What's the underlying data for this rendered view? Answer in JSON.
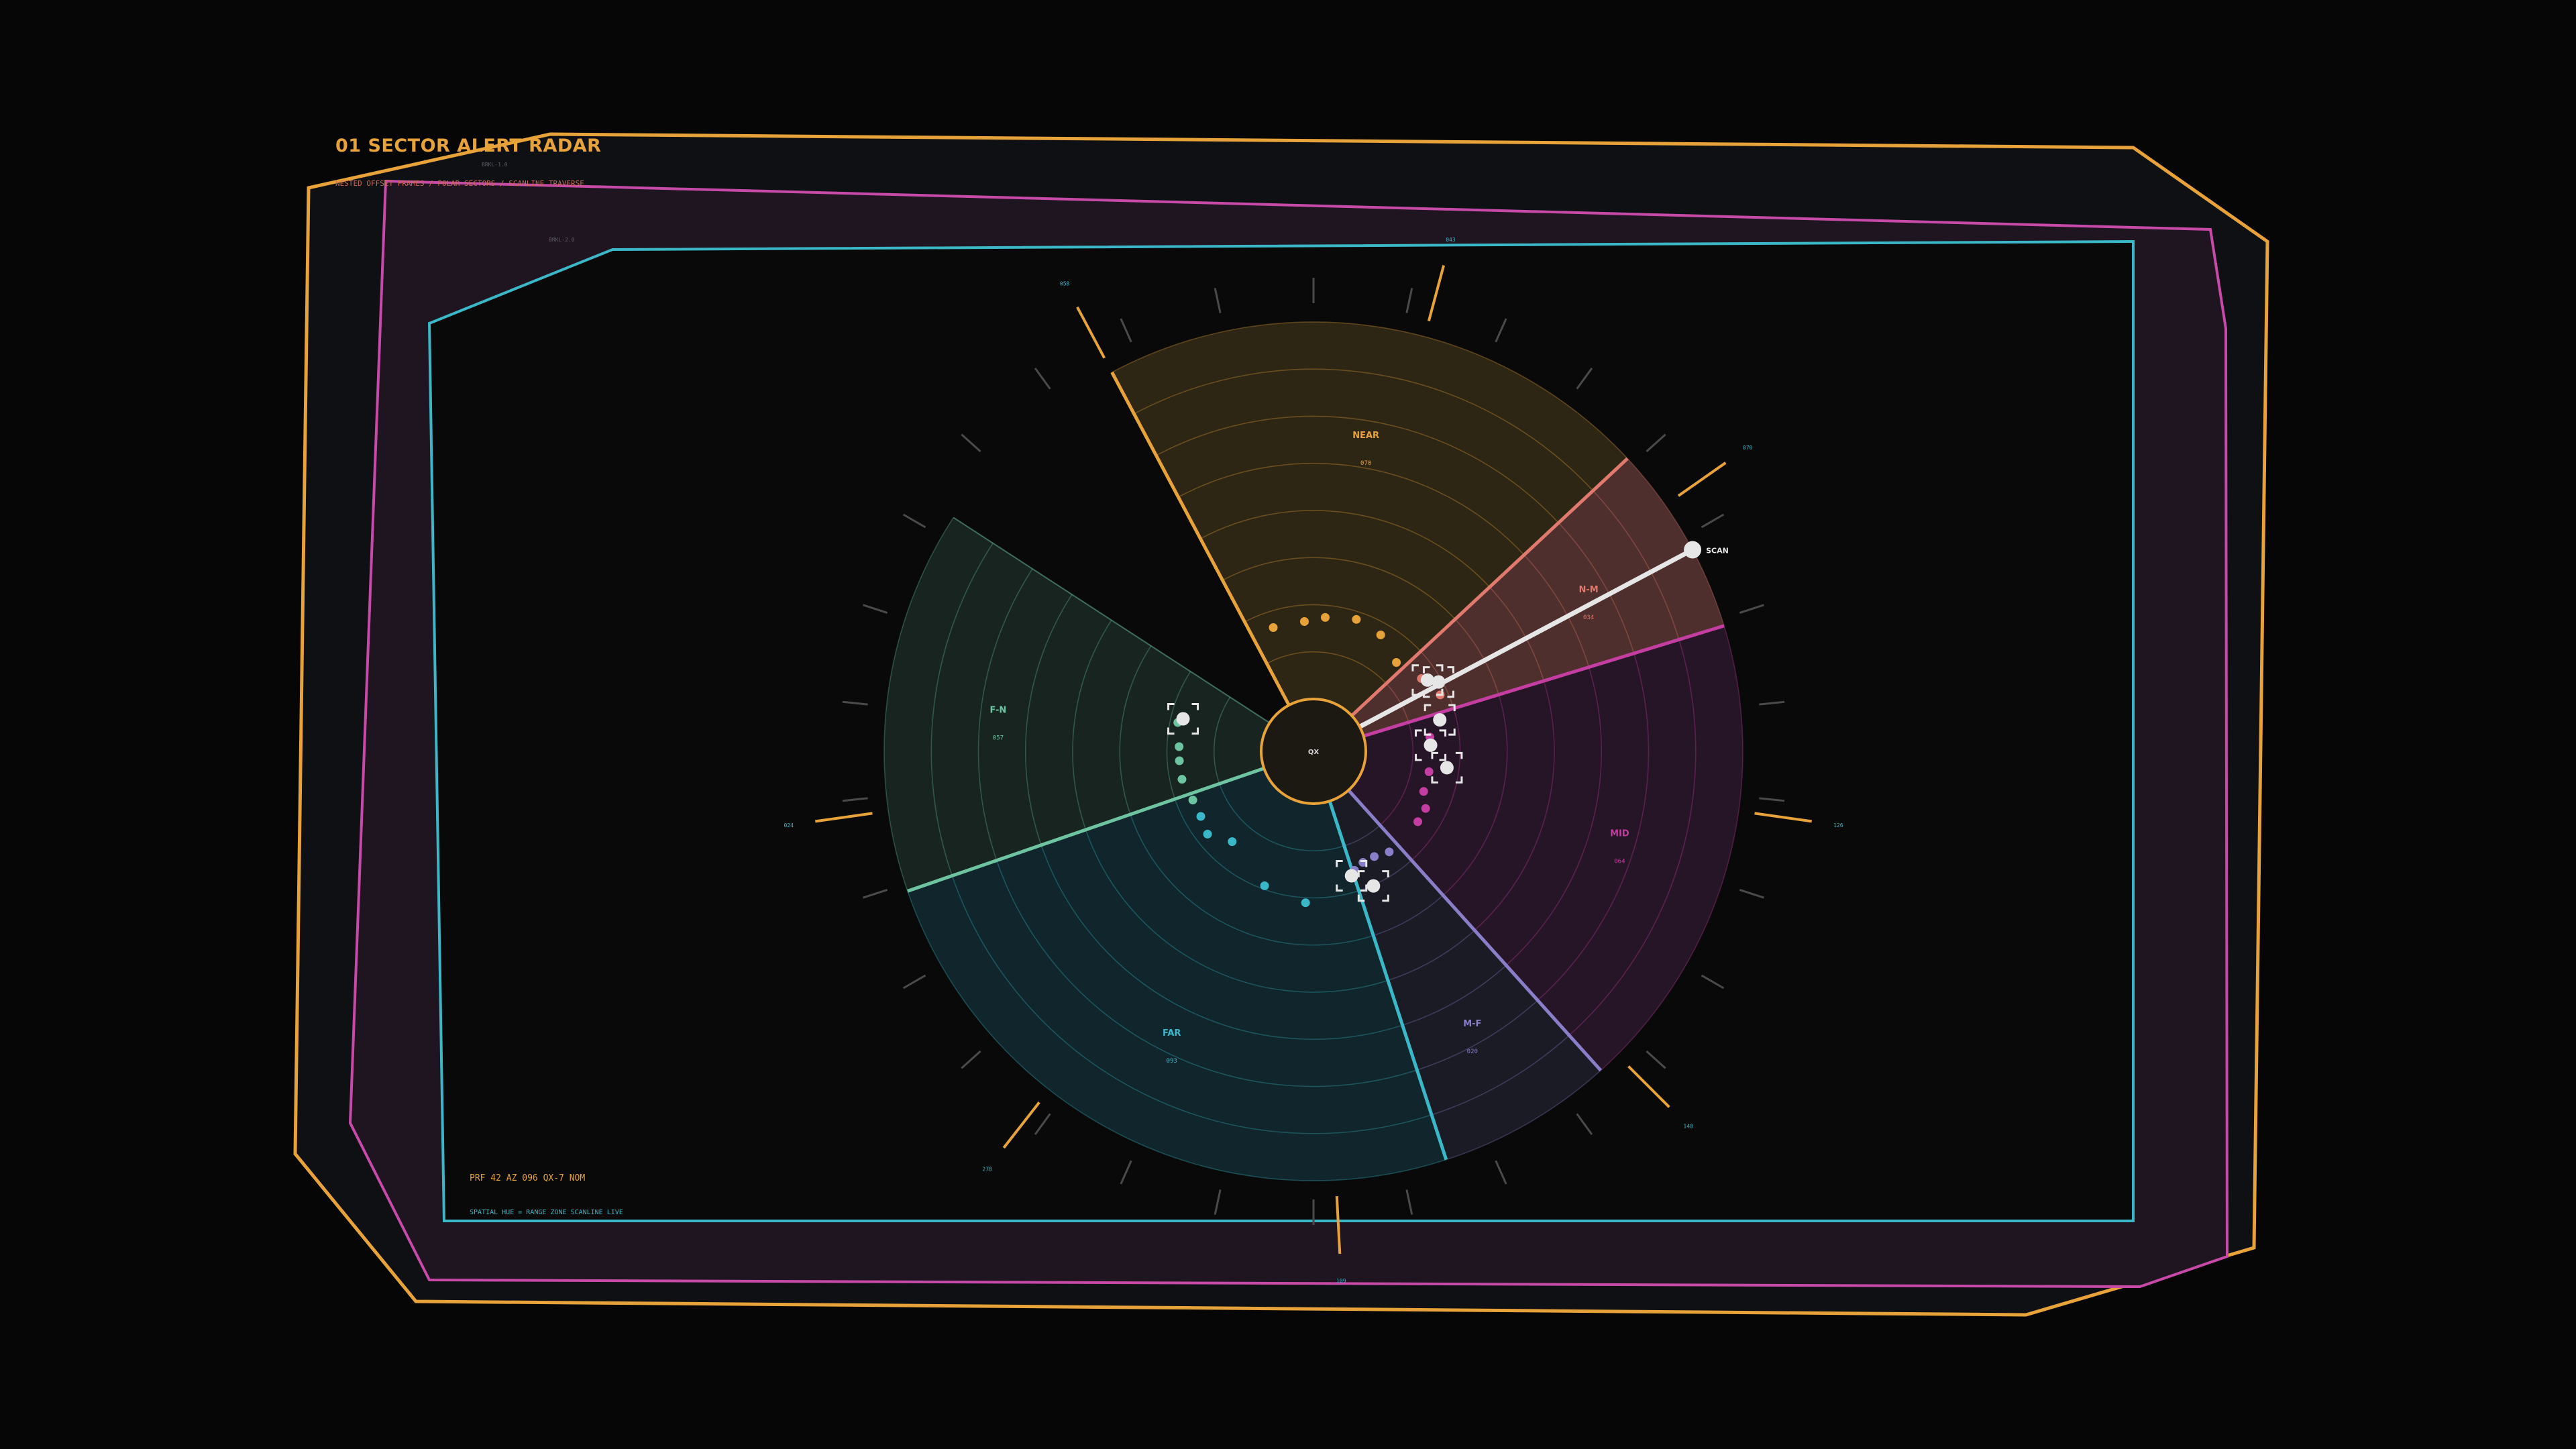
{
  "header": {
    "title": "01  SECTOR ALERT RADAR",
    "subtitle": "NESTED OFFSET FRAMES / POLAR SECTORS / SCANLINE TRAVERSE",
    "frame_tag_a": "BRKL-1.0",
    "frame_tag_b": "BRKL-2.0"
  },
  "footer": {
    "status_line": "PRF 42   AZ 096   QX-7 NOM",
    "legend_line": "SPATIAL HUE = RANGE ZONE  SCANLINE LIVE"
  },
  "core": {
    "label": "QX"
  },
  "scan": {
    "label": "SCAN",
    "azimuth_deg": 62
  },
  "colors": {
    "background": "#060606",
    "frame_outer": "#e8a23a",
    "frame_middle": "#c84aa8",
    "frame_inner": "#3ab8c8",
    "near": "#e8a23a",
    "near_mid": "#e07a6e",
    "mid": "#c33ea0",
    "mid_far": "#8a7ec8",
    "far": "#3ab8c8",
    "far_near": "#6ec4a0",
    "scan": "#e6e6e6"
  },
  "sectors": [
    {
      "id": "near",
      "label": "NEAR",
      "value": "070",
      "color": "#e8a23a",
      "fill": "#2e2614",
      "start_deg": -28,
      "end_deg": 47
    },
    {
      "id": "near_mid",
      "label": "N-M",
      "value": "034",
      "color": "#e07a6e",
      "fill": "#4e2f2d",
      "start_deg": 47,
      "end_deg": 73
    },
    {
      "id": "mid",
      "label": "MID",
      "value": "064",
      "color": "#c33ea0",
      "fill": "#261527",
      "start_deg": 73,
      "end_deg": 138
    },
    {
      "id": "mid_far",
      "label": "M-F",
      "value": "020",
      "color": "#8a7ec8",
      "fill": "#1b1b26",
      "start_deg": 138,
      "end_deg": 162
    },
    {
      "id": "far",
      "label": "FAR",
      "value": "093",
      "color": "#3ab8c8",
      "fill": "#10262c",
      "start_deg": 162,
      "end_deg": 251
    },
    {
      "id": "far_near",
      "label": "F-N",
      "value": "057",
      "color": "#6ec4a0",
      "fill": "#172420",
      "start_deg": 251,
      "end_deg": 303
    }
  ],
  "spokes": [
    {
      "label": "058",
      "azimuth_deg": -28
    },
    {
      "label": "043",
      "azimuth_deg": 15
    },
    {
      "label": "070",
      "azimuth_deg": 55
    },
    {
      "label": "126",
      "azimuth_deg": 98
    },
    {
      "label": "148",
      "azimuth_deg": 135
    },
    {
      "label": "109",
      "azimuth_deg": 177
    },
    {
      "label": "278",
      "azimuth_deg": 218
    },
    {
      "label": "024",
      "azimuth_deg": 262
    }
  ],
  "contacts": [
    {
      "sector": "near",
      "range": 0.23,
      "azimuth_deg": -18
    },
    {
      "sector": "near",
      "range": 0.23,
      "azimuth_deg": -4
    },
    {
      "sector": "near",
      "range": 0.24,
      "azimuth_deg": 5
    },
    {
      "sector": "near",
      "range": 0.25,
      "azimuth_deg": 18
    },
    {
      "sector": "near",
      "range": 0.24,
      "azimuth_deg": 30
    },
    {
      "sector": "near",
      "range": 0.21,
      "azimuth_deg": 43
    },
    {
      "sector": "near_mid",
      "range": 0.23,
      "azimuth_deg": 56
    },
    {
      "sector": "near_mid",
      "range": 0.25,
      "azimuth_deg": 66
    },
    {
      "sector": "mid",
      "range": 0.2,
      "azimuth_deg": 83
    },
    {
      "sector": "mid",
      "range": 0.2,
      "azimuth_deg": 100
    },
    {
      "sector": "mid",
      "range": 0.2,
      "azimuth_deg": 110
    },
    {
      "sector": "mid",
      "range": 0.22,
      "azimuth_deg": 117
    },
    {
      "sector": "mid",
      "range": 0.22,
      "azimuth_deg": 124
    },
    {
      "sector": "mid_far",
      "range": 0.22,
      "azimuth_deg": 143
    },
    {
      "sector": "mid_far",
      "range": 0.21,
      "azimuth_deg": 150
    },
    {
      "sector": "mid_far",
      "range": 0.21,
      "azimuth_deg": 156
    },
    {
      "sector": "mid_far",
      "range": 0.22,
      "azimuth_deg": 161
    },
    {
      "sector": "far",
      "range": 0.28,
      "azimuth_deg": 183
    },
    {
      "sector": "far",
      "range": 0.26,
      "azimuth_deg": 200
    },
    {
      "sector": "far",
      "range": 0.21,
      "azimuth_deg": 222
    },
    {
      "sector": "far",
      "range": 0.24,
      "azimuth_deg": 232
    },
    {
      "sector": "far",
      "range": 0.23,
      "azimuth_deg": 240
    },
    {
      "sector": "far_near",
      "range": 0.23,
      "azimuth_deg": 248
    },
    {
      "sector": "far_near",
      "range": 0.24,
      "azimuth_deg": 258
    },
    {
      "sector": "far_near",
      "range": 0.24,
      "azimuth_deg": 266
    },
    {
      "sector": "far_near",
      "range": 0.24,
      "azimuth_deg": 272
    },
    {
      "sector": "far_near",
      "range": 0.25,
      "azimuth_deg": 282
    }
  ],
  "locks": [
    {
      "range": 0.24,
      "azimuth_deg": 58
    },
    {
      "range": 0.26,
      "azimuth_deg": 61
    },
    {
      "range": 0.23,
      "azimuth_deg": 76
    },
    {
      "range": 0.2,
      "azimuth_deg": 87
    },
    {
      "range": 0.24,
      "azimuth_deg": 97
    },
    {
      "range": 0.23,
      "azimuth_deg": 163
    },
    {
      "range": 0.27,
      "azimuth_deg": 156
    },
    {
      "range": 0.24,
      "azimuth_deg": 284
    }
  ]
}
